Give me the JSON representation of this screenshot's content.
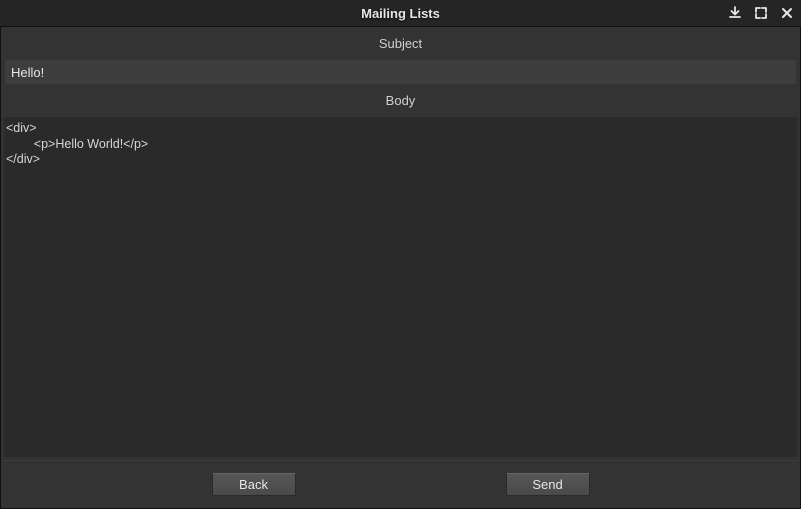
{
  "titlebar": {
    "title": "Mailing Lists"
  },
  "form": {
    "subject_label": "Subject",
    "subject_value": "Hello!",
    "body_label": "Body",
    "body_value": "<div>\n        <p>Hello World!</p>\n</div>"
  },
  "buttons": {
    "back": "Back",
    "send": "Send"
  }
}
